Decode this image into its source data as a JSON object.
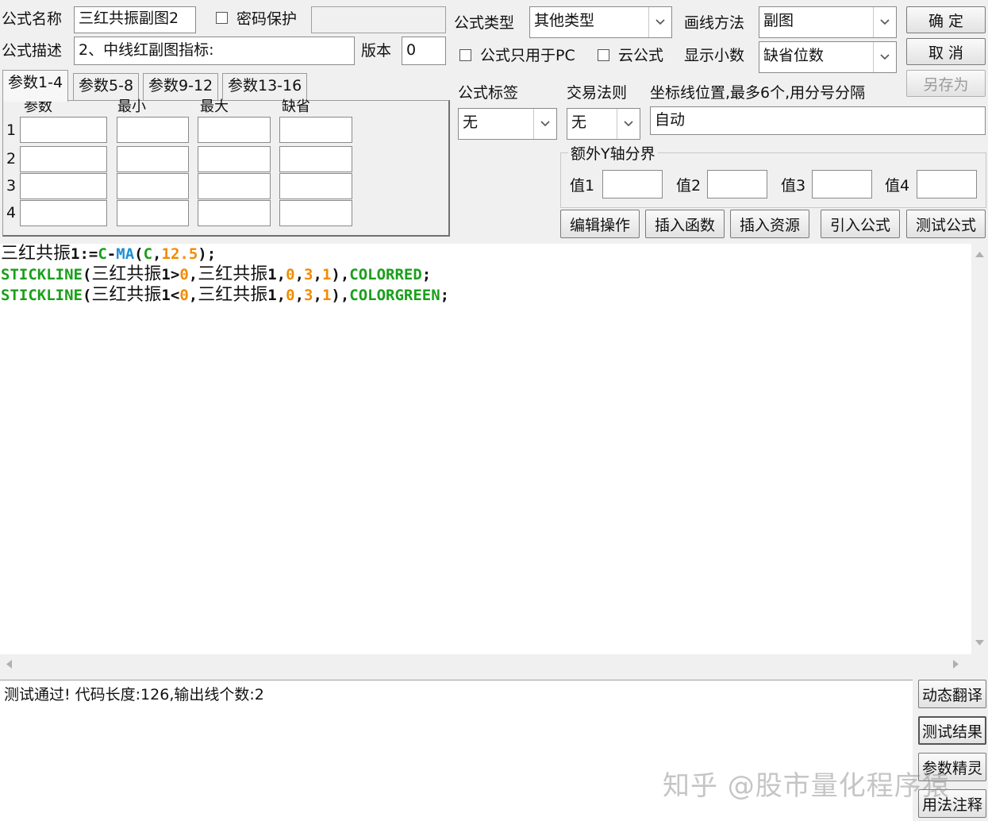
{
  "header": {
    "name_label": "公式名称",
    "name_value": "三红共振副图2",
    "password_label": "密码保护",
    "password_checked": false,
    "password_value": "",
    "desc_label": "公式描述",
    "desc_value": "2、中线红副图指标:",
    "version_label": "版本",
    "version_value": "0",
    "type_label": "公式类型",
    "type_value": "其他类型",
    "draw_label": "画线方法",
    "draw_value": "副图",
    "pc_only_label": "公式只用于PC",
    "pc_only_checked": false,
    "cloud_label": "云公式",
    "cloud_checked": false,
    "decimals_label": "显示小数",
    "decimals_value": "缺省位数"
  },
  "buttons": {
    "ok": "确  定",
    "cancel": "取  消",
    "save_as": "另存为"
  },
  "param_tabs": [
    "参数1-4",
    "参数5-8",
    "参数9-12",
    "参数13-16"
  ],
  "param_table": {
    "headers": [
      "参数",
      "最小",
      "最大",
      "缺省"
    ],
    "rows": [
      "1",
      "2",
      "3",
      "4"
    ]
  },
  "tags": {
    "tag_label": "公式标签",
    "tag_value": "无",
    "trade_label": "交易法则",
    "trade_value": "无",
    "axis_label": "坐标线位置,最多6个,用分号分隔",
    "axis_value": "自动"
  },
  "y_bounds": {
    "title": "额外Y轴分界",
    "labels": [
      "值1",
      "值2",
      "值3",
      "值4"
    ]
  },
  "action_buttons": [
    "编辑操作",
    "插入函数",
    "插入资源",
    "引入公式",
    "测试公式"
  ],
  "code": {
    "colors": {
      "text": "#111111",
      "function": "#1aa01a",
      "builtin": "#1e8fd6",
      "number": "#f08c00"
    },
    "lines": [
      [
        {
          "t": "三红共振",
          "c": "text",
          "cjk": true
        },
        {
          "t": "1:=",
          "c": "text"
        },
        {
          "t": "C",
          "c": "function"
        },
        {
          "t": "-",
          "c": "text"
        },
        {
          "t": "MA",
          "c": "builtin"
        },
        {
          "t": "(",
          "c": "text"
        },
        {
          "t": "C",
          "c": "function"
        },
        {
          "t": ",",
          "c": "text"
        },
        {
          "t": "12.5",
          "c": "number"
        },
        {
          "t": ");",
          "c": "text"
        }
      ],
      [
        {
          "t": "STICKLINE",
          "c": "function"
        },
        {
          "t": "(",
          "c": "text"
        },
        {
          "t": "三红共振",
          "c": "text",
          "cjk": true
        },
        {
          "t": "1>",
          "c": "text"
        },
        {
          "t": "0",
          "c": "number"
        },
        {
          "t": ",",
          "c": "text"
        },
        {
          "t": "三红共振",
          "c": "text",
          "cjk": true
        },
        {
          "t": "1,",
          "c": "text"
        },
        {
          "t": "0",
          "c": "number"
        },
        {
          "t": ",",
          "c": "text"
        },
        {
          "t": "3",
          "c": "number"
        },
        {
          "t": ",",
          "c": "text"
        },
        {
          "t": "1",
          "c": "number"
        },
        {
          "t": "),",
          "c": "text"
        },
        {
          "t": "COLORRED",
          "c": "function"
        },
        {
          "t": ";",
          "c": "text"
        }
      ],
      [
        {
          "t": "STICKLINE",
          "c": "function"
        },
        {
          "t": "(",
          "c": "text"
        },
        {
          "t": "三红共振",
          "c": "text",
          "cjk": true
        },
        {
          "t": "1<",
          "c": "text"
        },
        {
          "t": "0",
          "c": "number"
        },
        {
          "t": ",",
          "c": "text"
        },
        {
          "t": "三红共振",
          "c": "text",
          "cjk": true
        },
        {
          "t": "1,",
          "c": "text"
        },
        {
          "t": "0",
          "c": "number"
        },
        {
          "t": ",",
          "c": "text"
        },
        {
          "t": "3",
          "c": "number"
        },
        {
          "t": ",",
          "c": "text"
        },
        {
          "t": "1",
          "c": "number"
        },
        {
          "t": "),",
          "c": "text"
        },
        {
          "t": "COLORGREEN",
          "c": "function"
        },
        {
          "t": ";",
          "c": "text"
        }
      ]
    ]
  },
  "output": {
    "message": "测试通过! 代码长度:126,输出线个数:2"
  },
  "side_buttons": [
    "动态翻译",
    "测试结果",
    "参数精灵",
    "用法注释"
  ],
  "watermark": "知乎 @股市量化程序猿"
}
